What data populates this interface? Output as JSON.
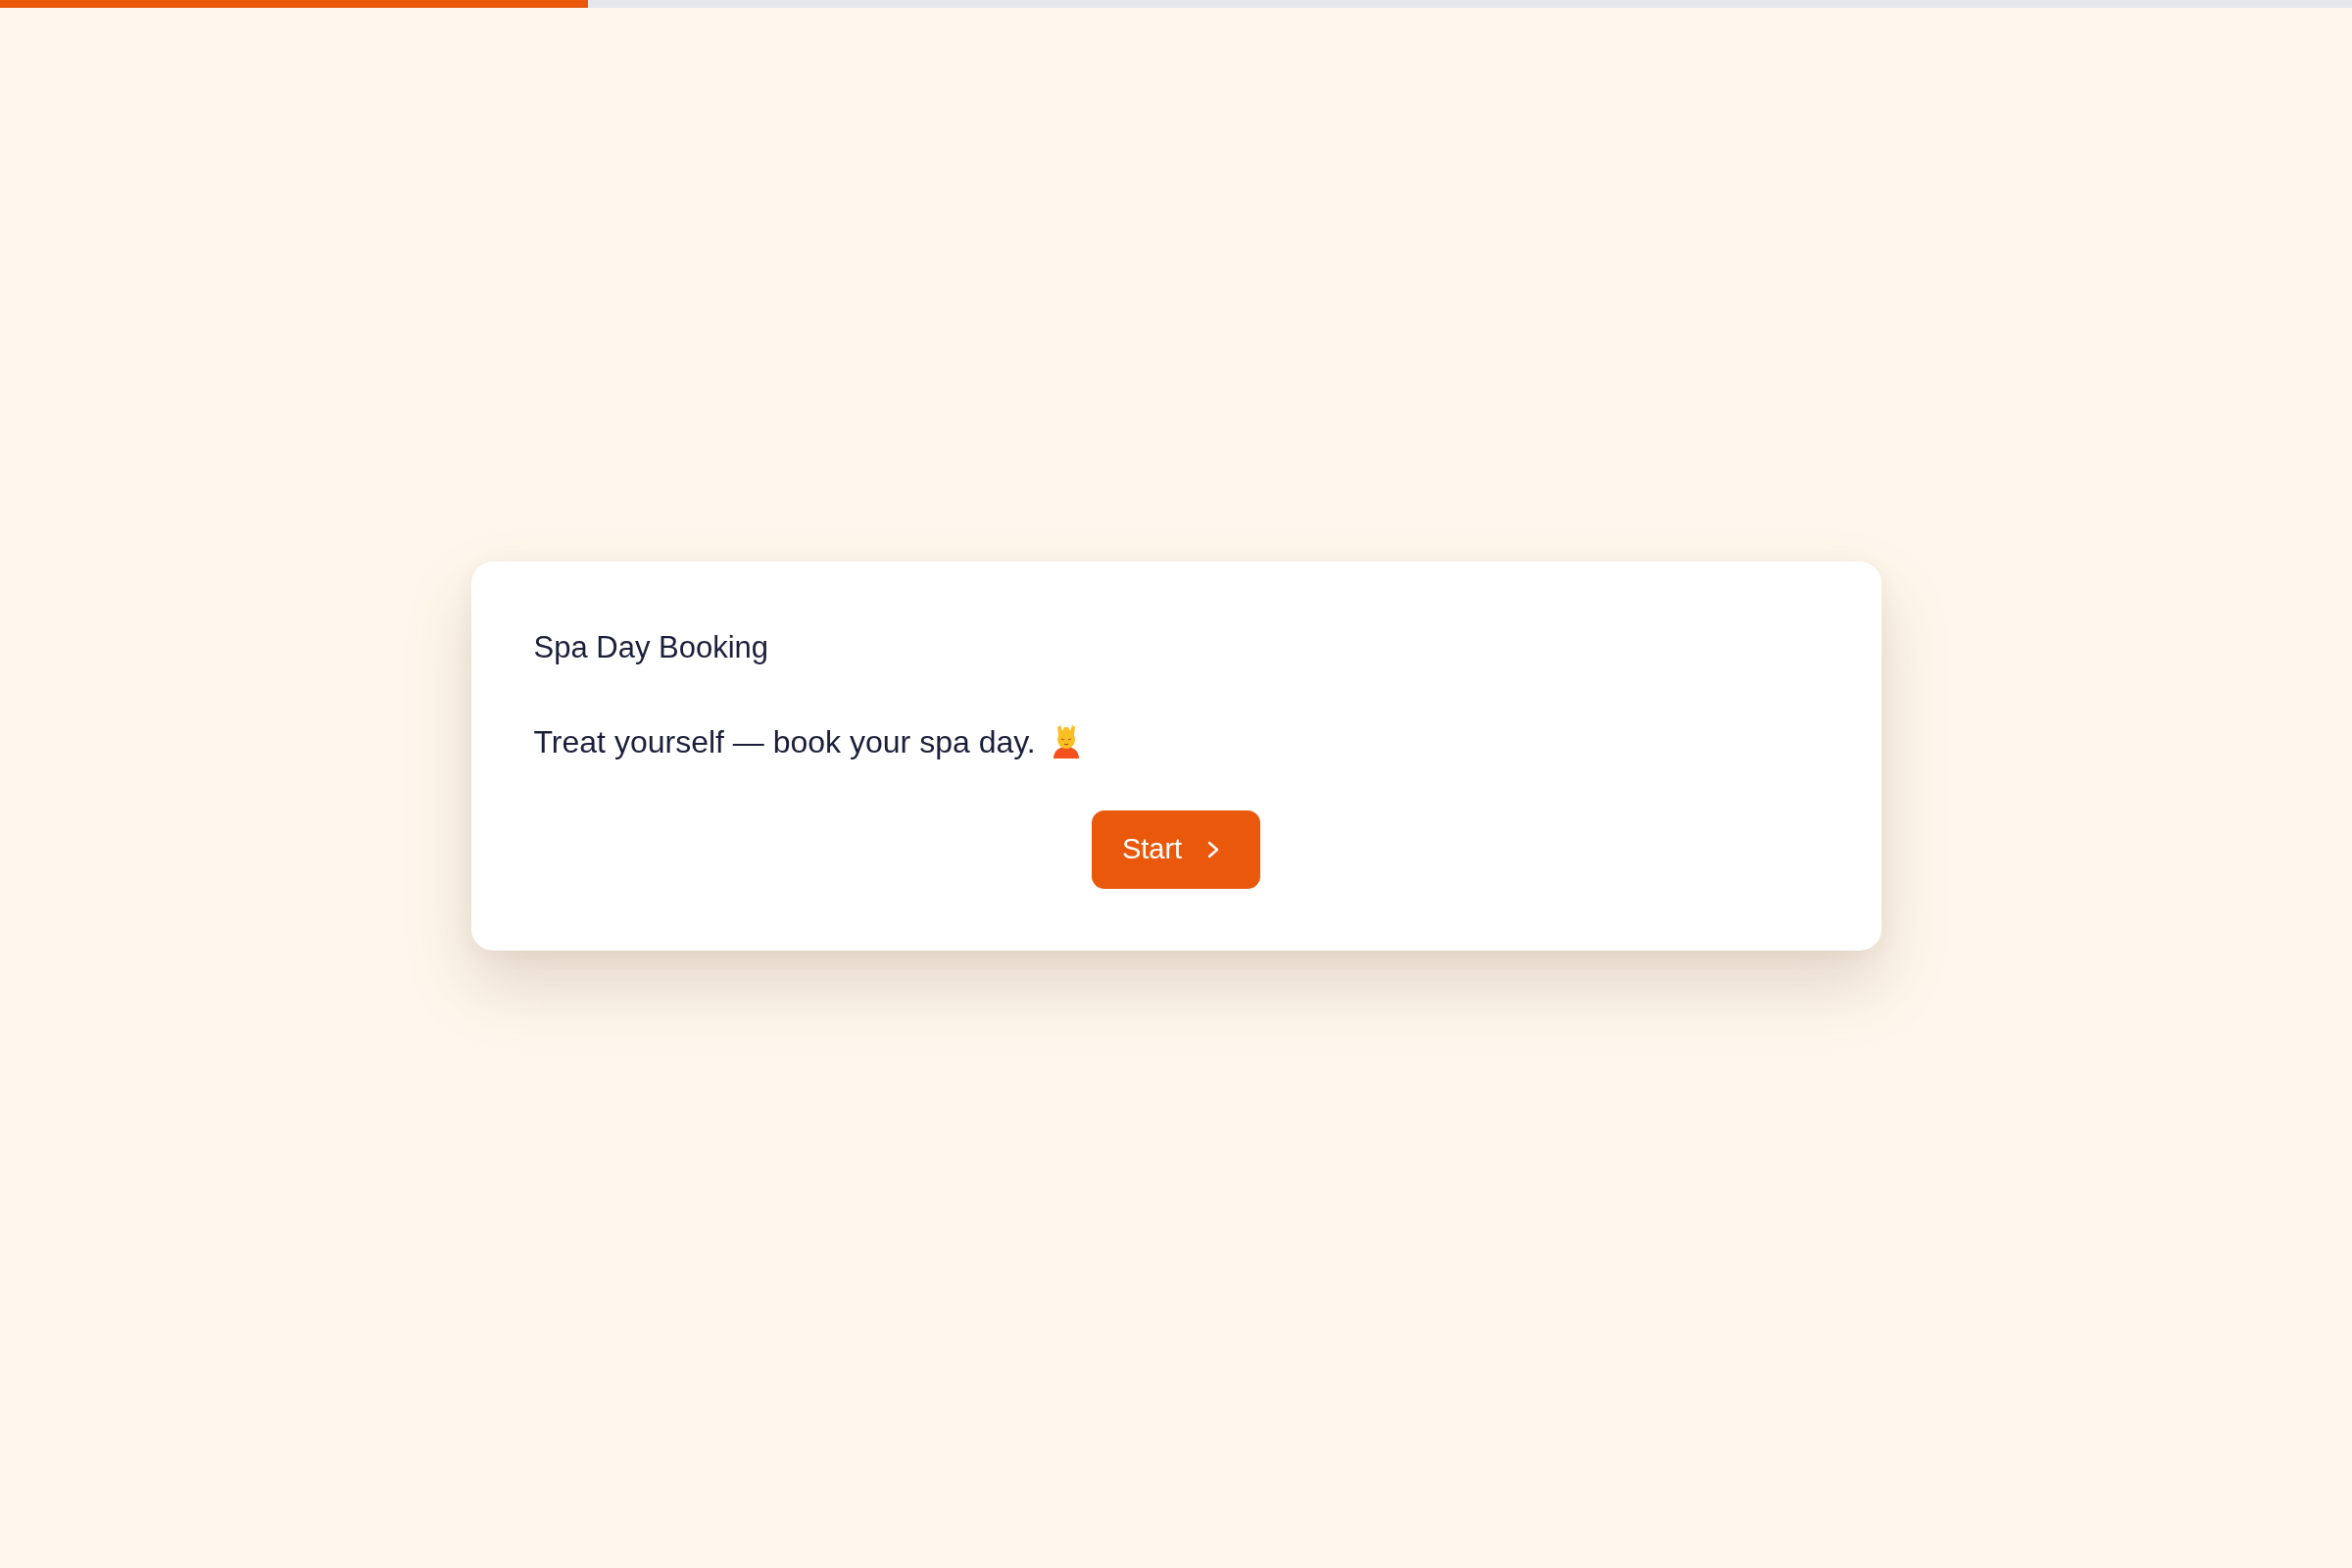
{
  "progress": {
    "level": 0.25
  },
  "card": {
    "title": "Spa Day Booking",
    "text": "Treat yourself — book your spa day.",
    "button": "Start"
  }
}
